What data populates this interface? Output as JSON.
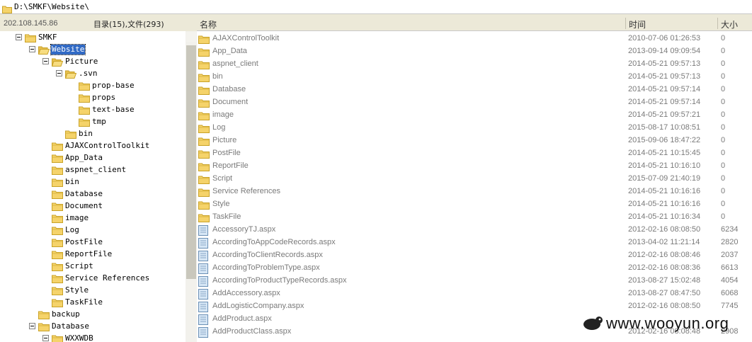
{
  "path": "D:\\SMKF\\Website\\",
  "info": {
    "ip": "202.108.145.86",
    "counts": "目录(15),文件(293)"
  },
  "columns": {
    "name": "名称",
    "time": "时间",
    "size": "大小"
  },
  "tree": [
    {
      "label": "SMKF",
      "level": 0,
      "toggle": true
    },
    {
      "label": "Website",
      "level": 1,
      "toggle": true,
      "selected": true,
      "open": true
    },
    {
      "label": "Picture",
      "level": 2,
      "toggle": true,
      "open": true
    },
    {
      "label": ".svn",
      "level": 3,
      "toggle": true,
      "open": true
    },
    {
      "label": "prop-base",
      "level": 4
    },
    {
      "label": "props",
      "level": 4
    },
    {
      "label": "text-base",
      "level": 4
    },
    {
      "label": "tmp",
      "level": 4
    },
    {
      "label": "bin",
      "level": 3
    },
    {
      "label": "AJAXControlToolkit",
      "level": 2
    },
    {
      "label": "App_Data",
      "level": 2
    },
    {
      "label": "aspnet_client",
      "level": 2
    },
    {
      "label": "bin",
      "level": 2
    },
    {
      "label": "Database",
      "level": 2
    },
    {
      "label": "Document",
      "level": 2
    },
    {
      "label": "image",
      "level": 2
    },
    {
      "label": "Log",
      "level": 2
    },
    {
      "label": "PostFile",
      "level": 2
    },
    {
      "label": "ReportFile",
      "level": 2
    },
    {
      "label": "Script",
      "level": 2
    },
    {
      "label": "Service References",
      "level": 2
    },
    {
      "label": "Style",
      "level": 2
    },
    {
      "label": "TaskFile",
      "level": 2
    },
    {
      "label": "backup",
      "level": 1
    },
    {
      "label": "Database",
      "level": 1,
      "toggle": true
    },
    {
      "label": "WXXWDB",
      "level": 2,
      "toggle": true
    }
  ],
  "files": [
    {
      "type": "folder",
      "name": "AJAXControlToolkit",
      "time": "2010-07-06 01:26:53",
      "size": "0"
    },
    {
      "type": "folder",
      "name": "App_Data",
      "time": "2013-09-14 09:09:54",
      "size": "0"
    },
    {
      "type": "folder",
      "name": "aspnet_client",
      "time": "2014-05-21 09:57:13",
      "size": "0"
    },
    {
      "type": "folder",
      "name": "bin",
      "time": "2014-05-21 09:57:13",
      "size": "0"
    },
    {
      "type": "folder",
      "name": "Database",
      "time": "2014-05-21 09:57:14",
      "size": "0"
    },
    {
      "type": "folder",
      "name": "Document",
      "time": "2014-05-21 09:57:14",
      "size": "0"
    },
    {
      "type": "folder",
      "name": "image",
      "time": "2014-05-21 09:57:21",
      "size": "0"
    },
    {
      "type": "folder",
      "name": "Log",
      "time": "2015-08-17 10:08:51",
      "size": "0"
    },
    {
      "type": "folder",
      "name": "Picture",
      "time": "2015-09-06 18:47:22",
      "size": "0"
    },
    {
      "type": "folder",
      "name": "PostFile",
      "time": "2014-05-21 10:15:45",
      "size": "0"
    },
    {
      "type": "folder",
      "name": "ReportFile",
      "time": "2014-05-21 10:16:10",
      "size": "0"
    },
    {
      "type": "folder",
      "name": "Script",
      "time": "2015-07-09 21:40:19",
      "size": "0"
    },
    {
      "type": "folder",
      "name": "Service References",
      "time": "2014-05-21 10:16:16",
      "size": "0"
    },
    {
      "type": "folder",
      "name": "Style",
      "time": "2014-05-21 10:16:16",
      "size": "0"
    },
    {
      "type": "folder",
      "name": "TaskFile",
      "time": "2014-05-21 10:16:34",
      "size": "0"
    },
    {
      "type": "file",
      "name": "AccessoryTJ.aspx",
      "time": "2012-02-16 08:08:50",
      "size": "6234"
    },
    {
      "type": "file",
      "name": "AccordingToAppCodeRecords.aspx",
      "time": "2013-04-02 11:21:14",
      "size": "2820"
    },
    {
      "type": "file",
      "name": "AccordingToClientRecords.aspx",
      "time": "2012-02-16 08:08:46",
      "size": "2037"
    },
    {
      "type": "file",
      "name": "AccordingToProblemType.aspx",
      "time": "2012-02-16 08:08:36",
      "size": "6613"
    },
    {
      "type": "file",
      "name": "AccordingToProductTypeRecords.aspx",
      "time": "2013-08-27 15:02:48",
      "size": "4054"
    },
    {
      "type": "file",
      "name": "AddAccessory.aspx",
      "time": "2013-08-27 08:47:50",
      "size": "6068"
    },
    {
      "type": "file",
      "name": "AddLogisticCompany.aspx",
      "time": "2012-02-16 08:08:50",
      "size": "7745"
    },
    {
      "type": "file",
      "name": "AddProduct.aspx",
      "time": "",
      "size": ""
    },
    {
      "type": "file",
      "name": "AddProductClass.aspx",
      "time": "2012-02-16 08:08:48",
      "size": "2908"
    }
  ],
  "watermark": "www.wooyun.org",
  "colors": {
    "folder": "#f5d36a",
    "folder_edge": "#c9a227",
    "selection": "#316ac5",
    "header_bg": "#ece9d8"
  }
}
